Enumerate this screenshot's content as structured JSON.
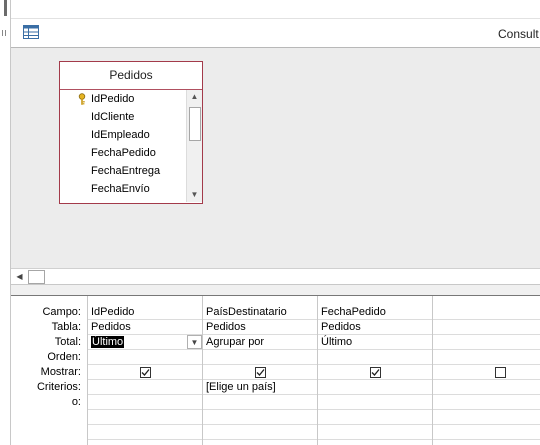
{
  "window": {
    "title": "Consult"
  },
  "table": {
    "name": "Pedidos",
    "fields": [
      {
        "label": "IdPedido",
        "primary_key": true
      },
      {
        "label": "IdCliente"
      },
      {
        "label": "IdEmpleado"
      },
      {
        "label": "FechaPedido"
      },
      {
        "label": "FechaEntrega"
      },
      {
        "label": "FechaEnvío"
      }
    ]
  },
  "grid": {
    "row_labels": [
      "Campo:",
      "Tabla:",
      "Total:",
      "Orden:",
      "Mostrar:",
      "Criterios:",
      "o:"
    ],
    "columns": [
      {
        "campo": "IdPedido",
        "tabla": "Pedidos",
        "total": "Último",
        "orden": "",
        "mostrar": true,
        "criterios": "",
        "o": ""
      },
      {
        "campo": "PaísDestinatario",
        "tabla": "Pedidos",
        "total": "Agrupar por",
        "orden": "",
        "mostrar": true,
        "criterios": "[Elige un país]",
        "o": ""
      },
      {
        "campo": "FechaPedido",
        "tabla": "Pedidos",
        "total": "Último",
        "orden": "",
        "mostrar": true,
        "criterios": "",
        "o": ""
      },
      {
        "campo": "",
        "tabla": "",
        "total": "",
        "orden": "",
        "mostrar": false,
        "criterios": "",
        "o": ""
      }
    ]
  },
  "colors": {
    "table_border": "#a33a4a",
    "selection": "#000000",
    "check": "#1f1f1f"
  },
  "icons": [
    "key-icon",
    "query-design-icon",
    "dropdown-arrow-icon",
    "scroll-up-icon",
    "scroll-down-icon",
    "scroll-left-icon"
  ]
}
